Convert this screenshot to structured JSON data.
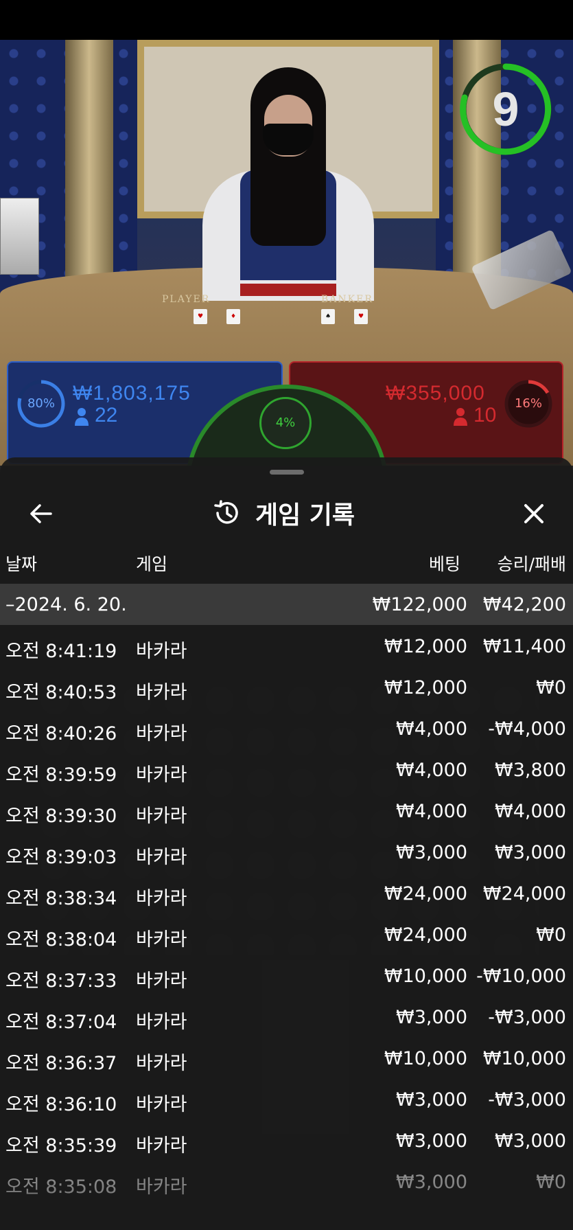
{
  "video": {
    "timer": "9",
    "table_labels": {
      "player": "PLAYER",
      "banker": "BANKER"
    }
  },
  "bets": {
    "player": {
      "percent": "80%",
      "amount": "₩1,803,175",
      "players": "22"
    },
    "banker": {
      "percent": "16%",
      "amount": "₩355,000",
      "players": "10"
    },
    "tie": {
      "percent": "4%"
    },
    "colors": {
      "player": "#2c5ec8",
      "banker": "#b52328",
      "tie": "#2fa52f"
    }
  },
  "history": {
    "title": "게임 기록",
    "icons": {
      "back": "arrow-left-icon",
      "title": "history-clock-icon",
      "close": "close-icon"
    },
    "columns": {
      "date": "날짜",
      "game": "게임",
      "bet": "베팅",
      "winloss": "승리/패배"
    },
    "day": {
      "date": "–2024. 6. 20.",
      "bet": "₩122,000",
      "winloss": "₩42,200"
    },
    "rows": [
      {
        "time": "오전 8:41:19",
        "game": "바카라",
        "bet": "₩12,000",
        "winloss": "₩11,400"
      },
      {
        "time": "오전 8:40:53",
        "game": "바카라",
        "bet": "₩12,000",
        "winloss": "₩0"
      },
      {
        "time": "오전 8:40:26",
        "game": "바카라",
        "bet": "₩4,000",
        "winloss": "-₩4,000"
      },
      {
        "time": "오전 8:39:59",
        "game": "바카라",
        "bet": "₩4,000",
        "winloss": "₩3,800"
      },
      {
        "time": "오전 8:39:30",
        "game": "바카라",
        "bet": "₩4,000",
        "winloss": "₩4,000"
      },
      {
        "time": "오전 8:39:03",
        "game": "바카라",
        "bet": "₩3,000",
        "winloss": "₩3,000"
      },
      {
        "time": "오전 8:38:34",
        "game": "바카라",
        "bet": "₩24,000",
        "winloss": "₩24,000"
      },
      {
        "time": "오전 8:38:04",
        "game": "바카라",
        "bet": "₩24,000",
        "winloss": "₩0"
      },
      {
        "time": "오전 8:37:33",
        "game": "바카라",
        "bet": "₩10,000",
        "winloss": "-₩10,000"
      },
      {
        "time": "오전 8:37:04",
        "game": "바카라",
        "bet": "₩3,000",
        "winloss": "-₩3,000"
      },
      {
        "time": "오전 8:36:37",
        "game": "바카라",
        "bet": "₩10,000",
        "winloss": "₩10,000"
      },
      {
        "time": "오전 8:36:10",
        "game": "바카라",
        "bet": "₩3,000",
        "winloss": "-₩3,000"
      },
      {
        "time": "오전 8:35:39",
        "game": "바카라",
        "bet": "₩3,000",
        "winloss": "₩3,000"
      },
      {
        "time": "오전 8:35:08",
        "game": "바카라",
        "bet": "₩3,000",
        "winloss": "₩0"
      }
    ]
  }
}
